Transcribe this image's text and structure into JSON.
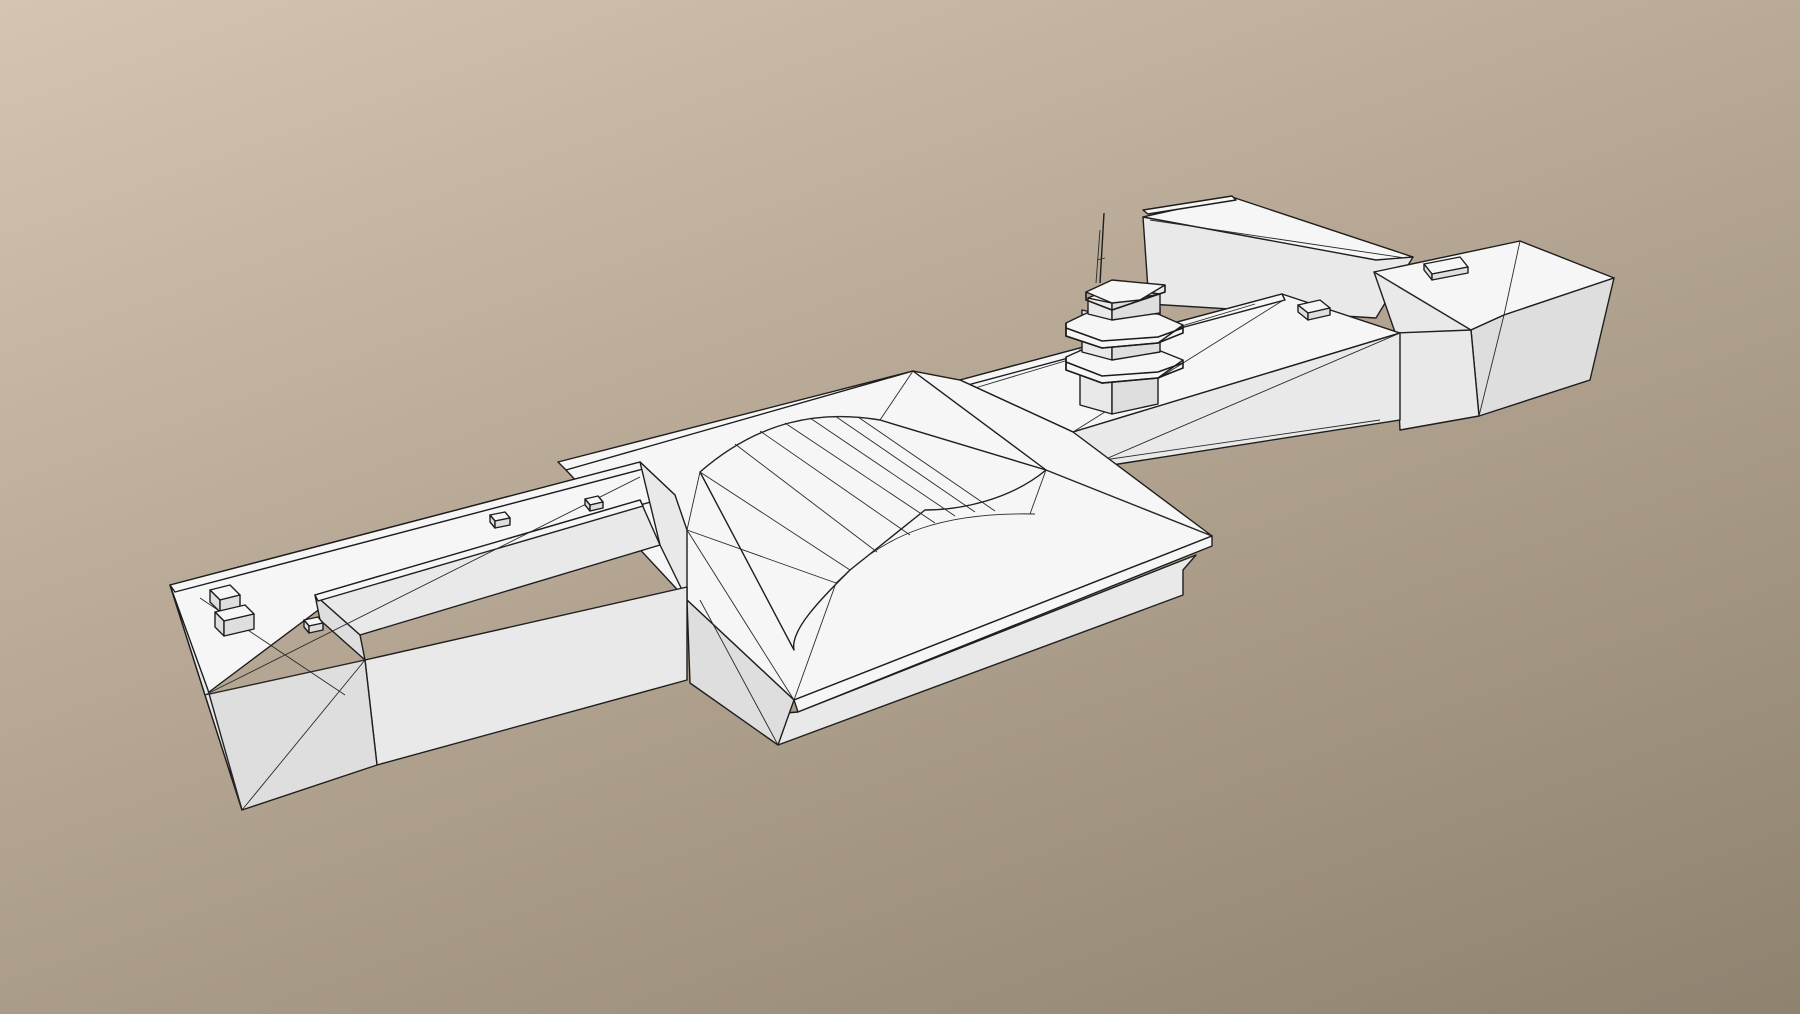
{
  "scene": {
    "background_top": "#d4c5b1",
    "background_bottom": "#8f826f",
    "model_fill": "#f6f6f6",
    "wire_color": "#1e1e1e"
  }
}
